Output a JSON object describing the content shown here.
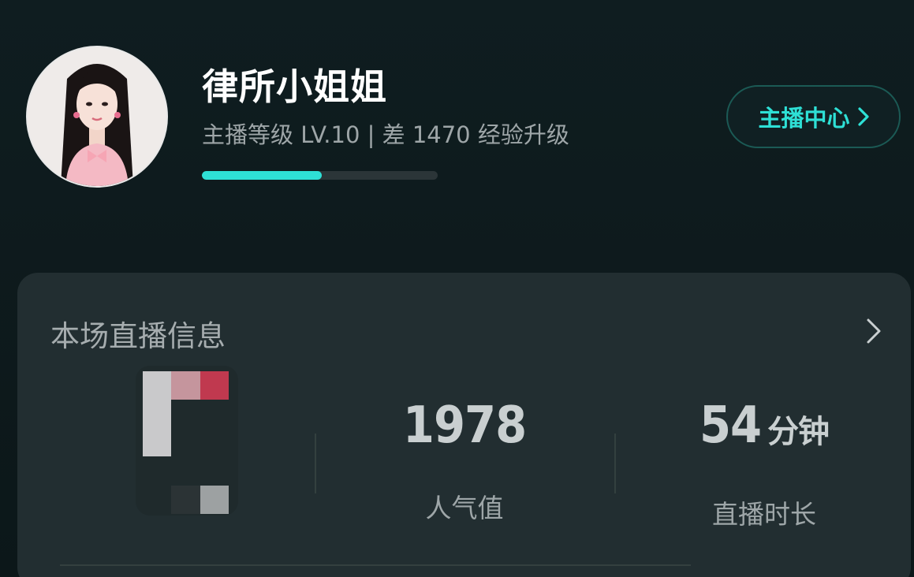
{
  "profile": {
    "name": "律所小姐姐",
    "level_text": "主播等级 LV.10 | 差 1470 经验升级",
    "level_progress": 0.51
  },
  "header": {
    "center_button_label": "主播中心"
  },
  "live_card": {
    "title": "本场直播信息",
    "stats": [
      {
        "value": "1978",
        "unit": "",
        "label": "人气值"
      },
      {
        "value": "54",
        "unit": "分钟",
        "label": "直播时长"
      }
    ]
  },
  "colors": {
    "accent": "#2ee0d6",
    "background": "#0e1a1c",
    "card": "#222e31"
  },
  "icons": {
    "center_button": "chevron-right-icon",
    "card_arrow": "chevron-right-icon"
  }
}
